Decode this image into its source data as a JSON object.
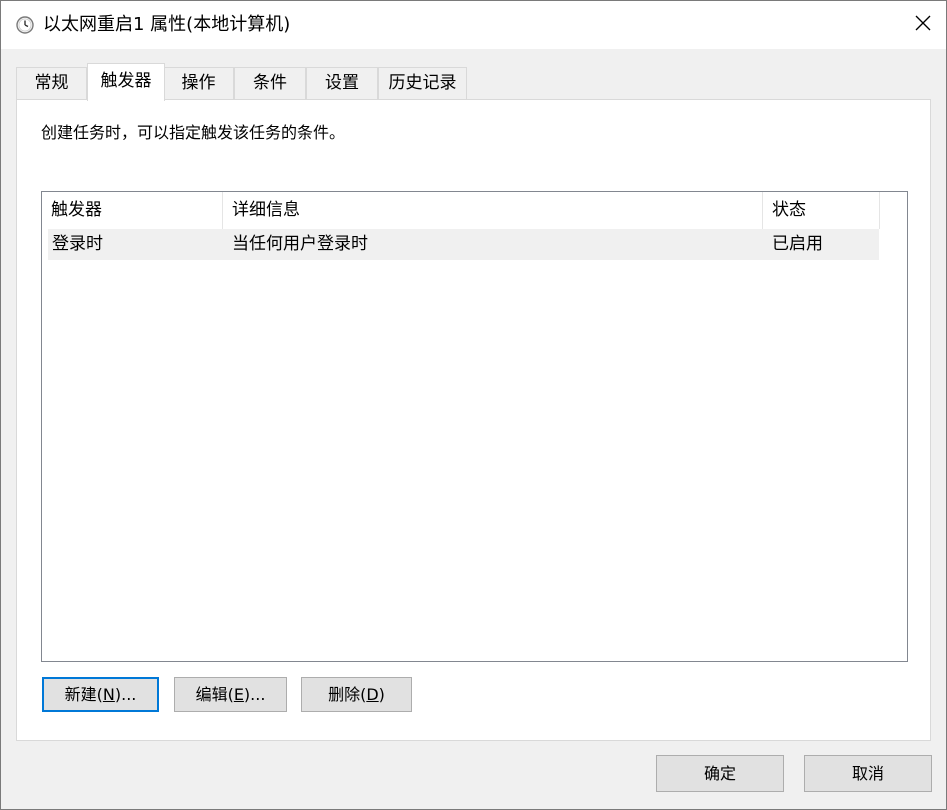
{
  "window": {
    "title": "以太网重启1 属性(本地计算机)",
    "icon": "clock-icon",
    "close_icon": "close-icon"
  },
  "tabs": [
    {
      "label": "常规",
      "active": false
    },
    {
      "label": "触发器",
      "active": true
    },
    {
      "label": "操作",
      "active": false
    },
    {
      "label": "条件",
      "active": false
    },
    {
      "label": "设置",
      "active": false
    },
    {
      "label": "历史记录",
      "active": false
    }
  ],
  "triggers_page": {
    "description": "创建任务时，可以指定触发该任务的条件。",
    "list": {
      "columns": [
        "触发器",
        "详细信息",
        "状态"
      ],
      "rows": [
        {
          "trigger": "登录时",
          "details": "当任何用户登录时",
          "status": "已启用"
        }
      ]
    },
    "buttons": {
      "new_prefix": "新建(",
      "new_key": "N",
      "new_suffix": ")...",
      "edit_prefix": "编辑(",
      "edit_key": "E",
      "edit_suffix": ")...",
      "delete_prefix": "删除(",
      "delete_key": "D",
      "delete_suffix": ")"
    }
  },
  "footer": {
    "ok_label": "确定",
    "cancel_label": "取消"
  },
  "colors": {
    "focus_border": "#0078d7",
    "window_bg": "#f0f0f0",
    "panel_bg": "#ffffff"
  }
}
